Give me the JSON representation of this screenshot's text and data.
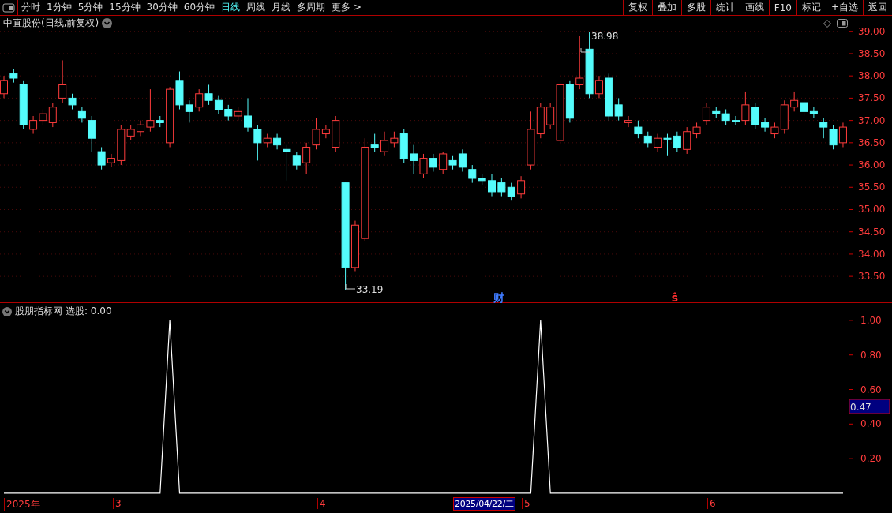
{
  "toolbar": {
    "periods": [
      {
        "label": "分时",
        "selected": false
      },
      {
        "label": "1分钟",
        "selected": false
      },
      {
        "label": "5分钟",
        "selected": false
      },
      {
        "label": "15分钟",
        "selected": false
      },
      {
        "label": "30分钟",
        "selected": false
      },
      {
        "label": "60分钟",
        "selected": false
      },
      {
        "label": "日线",
        "selected": true
      },
      {
        "label": "周线",
        "selected": false
      },
      {
        "label": "月线",
        "selected": false
      },
      {
        "label": "多周期",
        "selected": false
      },
      {
        "label": "更多 >",
        "selected": false
      }
    ],
    "actions": [
      "复权",
      "叠加",
      "多股",
      "统计",
      "画线",
      "F10",
      "标记",
      "+自选",
      "返回"
    ]
  },
  "main_chart": {
    "title": "中直股份(日线,前复权)",
    "high_label": "38.98",
    "low_label": "33.19",
    "chart_data": {
      "type": "candlestick",
      "grid": true,
      "ylim": [
        32.9,
        39.35
      ],
      "yticks": [
        {
          "value": 39,
          "label": "39.00"
        },
        {
          "value": 38.5,
          "label": "38.50"
        },
        {
          "value": 38,
          "label": "38.00"
        },
        {
          "value": 37.5,
          "label": "37.50"
        },
        {
          "value": 37,
          "label": "37.00"
        },
        {
          "value": 36.5,
          "label": "36.50"
        },
        {
          "value": 36,
          "label": "36.00"
        },
        {
          "value": 35.5,
          "label": "35.50"
        },
        {
          "value": 35,
          "label": "35.00"
        },
        {
          "value": 34.5,
          "label": "34.50"
        },
        {
          "value": 34,
          "label": "34.00"
        },
        {
          "value": 33.5,
          "label": "33.50"
        }
      ],
      "ohlc": [
        [
          37.6,
          38.0,
          37.5,
          37.9
        ],
        [
          38.05,
          38.15,
          37.85,
          37.95
        ],
        [
          37.8,
          37.9,
          36.8,
          36.9
        ],
        [
          36.8,
          37.1,
          36.7,
          37.0
        ],
        [
          37.0,
          37.25,
          36.9,
          37.15
        ],
        [
          36.95,
          37.4,
          36.85,
          37.3
        ],
        [
          37.5,
          38.35,
          37.4,
          37.8
        ],
        [
          37.5,
          37.6,
          37.25,
          37.35
        ],
        [
          37.2,
          37.3,
          36.95,
          37.05
        ],
        [
          37.0,
          37.1,
          36.3,
          36.6
        ],
        [
          36.3,
          36.4,
          35.9,
          36.0
        ],
        [
          36.05,
          36.25,
          35.95,
          36.15
        ],
        [
          36.1,
          36.9,
          36.0,
          36.8
        ],
        [
          36.65,
          36.9,
          36.55,
          36.8
        ],
        [
          36.75,
          37.0,
          36.65,
          36.9
        ],
        [
          36.85,
          37.7,
          36.75,
          37.0
        ],
        [
          37.0,
          37.1,
          36.85,
          36.95
        ],
        [
          36.5,
          37.75,
          36.4,
          37.7
        ],
        [
          37.9,
          38.1,
          37.25,
          37.35
        ],
        [
          37.35,
          37.45,
          36.95,
          37.2
        ],
        [
          37.3,
          37.7,
          37.2,
          37.6
        ],
        [
          37.6,
          37.8,
          37.35,
          37.45
        ],
        [
          37.45,
          37.55,
          37.15,
          37.25
        ],
        [
          37.25,
          37.35,
          37.0,
          37.1
        ],
        [
          37.1,
          37.3,
          37.0,
          37.2
        ],
        [
          37.1,
          37.5,
          36.75,
          36.85
        ],
        [
          36.8,
          36.9,
          36.1,
          36.5
        ],
        [
          36.5,
          36.7,
          36.4,
          36.6
        ],
        [
          36.6,
          36.7,
          36.35,
          36.45
        ],
        [
          36.35,
          36.45,
          35.65,
          36.3
        ],
        [
          36.2,
          36.3,
          35.9,
          36.0
        ],
        [
          36.05,
          36.5,
          35.8,
          36.4
        ],
        [
          36.45,
          37.05,
          36.35,
          36.8
        ],
        [
          36.7,
          36.9,
          36.6,
          36.8
        ],
        [
          36.4,
          37.1,
          36.3,
          37.0
        ],
        [
          35.6,
          35.6,
          33.19,
          33.7
        ],
        [
          33.7,
          34.75,
          33.6,
          34.65
        ],
        [
          34.35,
          36.6,
          34.3,
          36.4
        ],
        [
          36.45,
          36.7,
          36.3,
          36.4
        ],
        [
          36.3,
          36.75,
          36.2,
          36.55
        ],
        [
          36.5,
          36.75,
          36.4,
          36.6
        ],
        [
          36.7,
          36.8,
          36.05,
          36.15
        ],
        [
          36.25,
          36.45,
          35.8,
          36.1
        ],
        [
          35.8,
          36.25,
          35.7,
          36.15
        ],
        [
          36.15,
          36.25,
          35.85,
          35.95
        ],
        [
          35.9,
          36.3,
          35.8,
          36.25
        ],
        [
          36.1,
          36.2,
          35.9,
          36.0
        ],
        [
          36.25,
          36.35,
          35.85,
          35.95
        ],
        [
          35.9,
          36.0,
          35.6,
          35.7
        ],
        [
          35.7,
          35.8,
          35.55,
          35.65
        ],
        [
          35.65,
          35.8,
          35.3,
          35.4
        ],
        [
          35.6,
          35.7,
          35.3,
          35.4
        ],
        [
          35.5,
          35.6,
          35.2,
          35.3
        ],
        [
          35.35,
          35.75,
          35.25,
          35.65
        ],
        [
          36.0,
          37.2,
          35.9,
          36.8
        ],
        [
          36.7,
          37.4,
          36.6,
          37.3
        ],
        [
          36.9,
          37.4,
          36.8,
          37.3
        ],
        [
          36.55,
          37.9,
          36.45,
          37.8
        ],
        [
          37.8,
          37.9,
          36.95,
          37.05
        ],
        [
          37.8,
          38.9,
          37.7,
          37.95
        ],
        [
          38.6,
          38.98,
          37.5,
          37.6
        ],
        [
          37.6,
          38.0,
          37.5,
          37.9
        ],
        [
          37.95,
          38.05,
          37.0,
          37.1
        ],
        [
          37.35,
          37.5,
          37.0,
          37.1
        ],
        [
          36.95,
          37.1,
          36.85,
          37.0
        ],
        [
          36.85,
          37.0,
          36.6,
          36.7
        ],
        [
          36.65,
          36.75,
          36.4,
          36.5
        ],
        [
          36.4,
          36.7,
          36.3,
          36.6
        ],
        [
          36.6,
          36.7,
          36.2,
          36.58
        ],
        [
          36.65,
          36.75,
          36.3,
          36.4
        ],
        [
          36.35,
          36.85,
          36.25,
          36.75
        ],
        [
          36.7,
          36.95,
          36.6,
          36.85
        ],
        [
          37.0,
          37.4,
          36.9,
          37.3
        ],
        [
          37.2,
          37.3,
          37.05,
          37.15
        ],
        [
          37.15,
          37.25,
          36.9,
          37.0
        ],
        [
          37.0,
          37.1,
          36.9,
          36.98
        ],
        [
          37.0,
          37.65,
          36.9,
          37.35
        ],
        [
          37.3,
          37.4,
          36.8,
          36.9
        ],
        [
          36.95,
          37.05,
          36.75,
          36.85
        ],
        [
          36.7,
          36.95,
          36.6,
          36.85
        ],
        [
          36.8,
          37.45,
          36.7,
          37.35
        ],
        [
          37.3,
          37.65,
          37.2,
          37.45
        ],
        [
          37.4,
          37.5,
          37.1,
          37.2
        ],
        [
          37.2,
          37.3,
          37.05,
          37.15
        ],
        [
          36.95,
          37.05,
          36.6,
          36.85
        ],
        [
          36.8,
          36.9,
          36.35,
          36.45
        ],
        [
          36.5,
          36.95,
          36.4,
          36.85
        ]
      ]
    },
    "markers": [
      {
        "text": "财",
        "color": "#3f7bff"
      },
      {
        "text": "ŝ",
        "color": "#ff3030"
      }
    ]
  },
  "indicator": {
    "name": "股朋指标网",
    "label": "选股: 0.00",
    "cursor_value": "0.47",
    "chart_data": {
      "type": "line",
      "ylim": [
        -0.014,
        1.1
      ],
      "yticks": [
        {
          "value": 1,
          "label": "1.00"
        },
        {
          "value": 0.8,
          "label": "0.80"
        },
        {
          "value": 0.6,
          "label": "0.60"
        },
        {
          "value": 0.4,
          "label": "0.40"
        },
        {
          "value": 0.2,
          "label": "0.20"
        }
      ],
      "series": [
        {
          "color": "#ffffff",
          "values": [
            0,
            0,
            0,
            0,
            0,
            0,
            0,
            0,
            0,
            0,
            0,
            0,
            0,
            0,
            0,
            0,
            0,
            1,
            0,
            0,
            0,
            0,
            0,
            0,
            0,
            0,
            0,
            0,
            0,
            0,
            0,
            0,
            0,
            0,
            0,
            0,
            0,
            0,
            0,
            0,
            0,
            0,
            0,
            0,
            0,
            0,
            0,
            0,
            0,
            0,
            0,
            0,
            0,
            0,
            0,
            1,
            0,
            0,
            0,
            0,
            0,
            0,
            0,
            0,
            0,
            0,
            0,
            0,
            0,
            0,
            0,
            0,
            0,
            0,
            0,
            0,
            0,
            0,
            0,
            0,
            0,
            0,
            0,
            0,
            0,
            0,
            0
          ]
        }
      ]
    }
  },
  "time_axis": {
    "labels": [
      "2025年",
      "3",
      "4",
      "5",
      "6"
    ],
    "cursor_date": "2025/04/22/二"
  }
}
